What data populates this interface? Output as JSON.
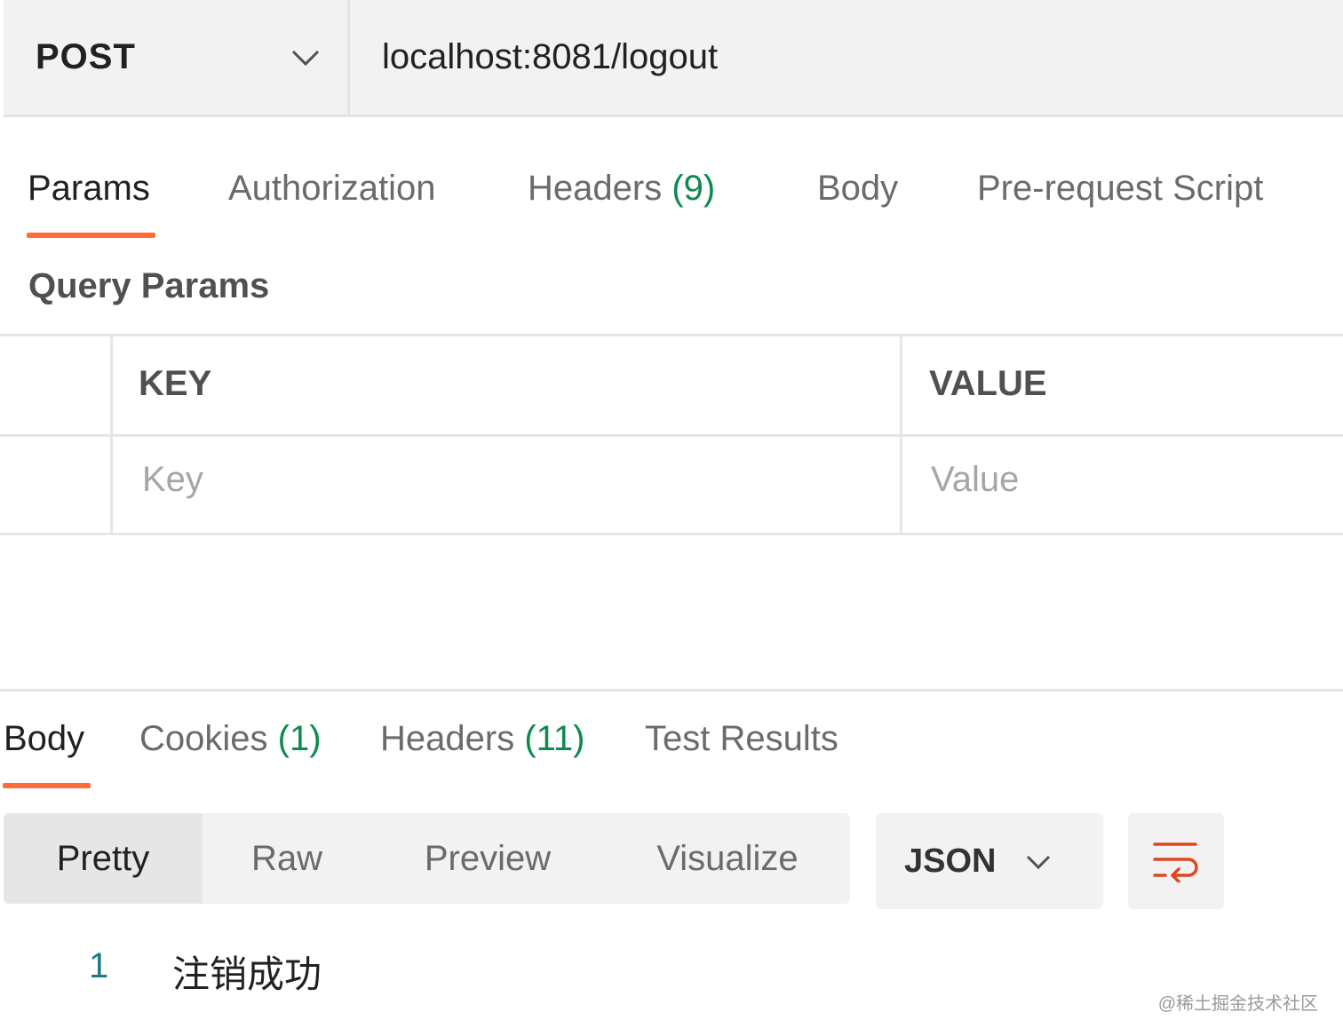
{
  "request": {
    "method": "POST",
    "url": "localhost:8081/logout"
  },
  "request_tabs": [
    {
      "label": "Params",
      "count": "",
      "active": true
    },
    {
      "label": "Authorization",
      "count": ""
    },
    {
      "label": "Headers",
      "count": "(9)"
    },
    {
      "label": "Body",
      "count": ""
    },
    {
      "label": "Pre-request Script",
      "count": ""
    }
  ],
  "query_params": {
    "title": "Query Params",
    "columns": [
      "KEY",
      "VALUE"
    ],
    "placeholders": {
      "key": "Key",
      "value": "Value"
    }
  },
  "response_tabs": [
    {
      "label": "Body",
      "count": "",
      "active": true
    },
    {
      "label": "Cookies",
      "count": "(1)"
    },
    {
      "label": "Headers",
      "count": "(11)"
    },
    {
      "label": "Test Results",
      "count": ""
    }
  ],
  "view_modes": [
    "Pretty",
    "Raw",
    "Preview",
    "Visualize"
  ],
  "active_view_mode": "Pretty",
  "format": "JSON",
  "response_body": [
    {
      "line": "1",
      "text": "注销成功"
    }
  ],
  "watermark": "@稀土掘金技术社区",
  "colors": {
    "accent": "#ff6c37",
    "count_green": "#0f8a4f",
    "line_number": "#1a7a8c"
  },
  "icons": [
    "chevron-down-icon",
    "wrap-lines-icon"
  ]
}
